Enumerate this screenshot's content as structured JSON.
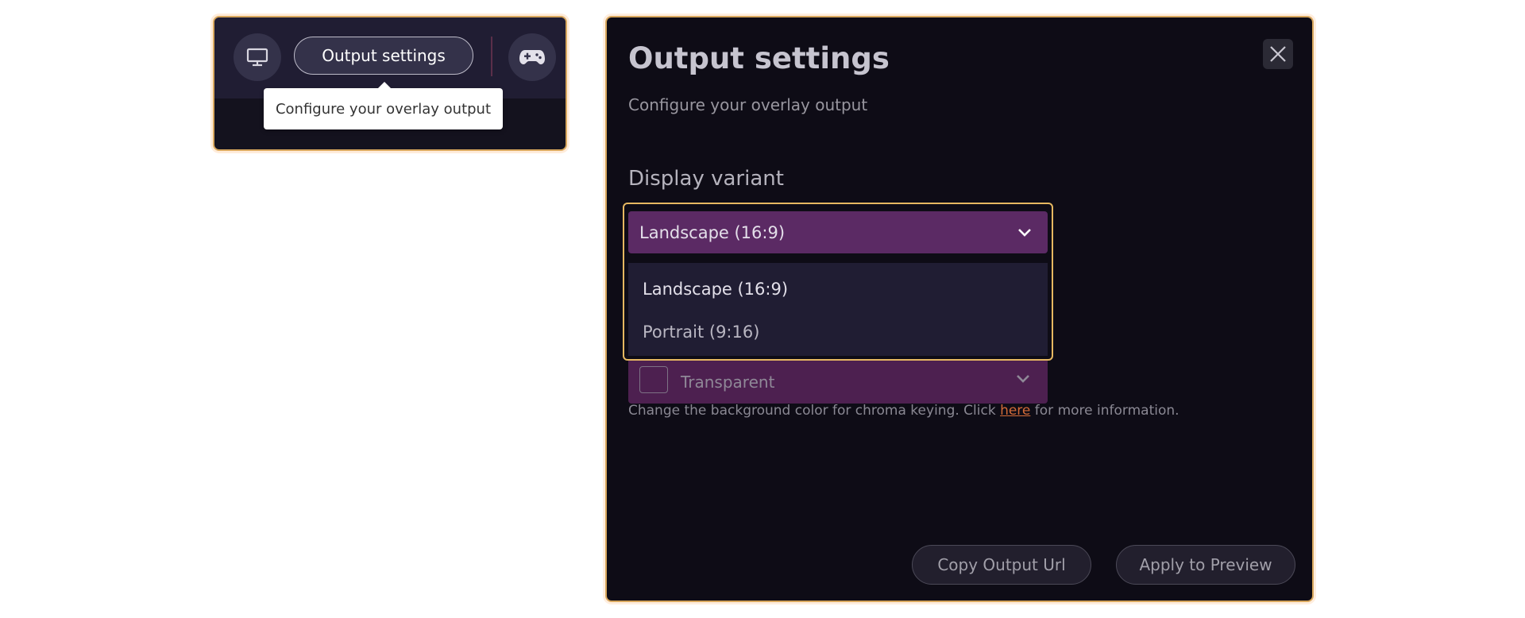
{
  "toolbar": {
    "monitor_icon": "monitor-icon",
    "output_settings_label": "Output settings",
    "gamepad_icon": "gamepad-icon",
    "tooltip": "Configure your overlay output"
  },
  "modal": {
    "title": "Output settings",
    "subtitle": "Configure your overlay output",
    "close_icon": "close-icon",
    "display_variant": {
      "label": "Display variant",
      "selected": "Landscape (16:9)",
      "options": [
        "Landscape (16:9)",
        "Portrait (9:16)"
      ]
    },
    "background": {
      "selected": "Transparent",
      "help_prefix": "Change the background color for chroma keying. Click ",
      "help_link": "here",
      "help_suffix": " for more information."
    },
    "footer": {
      "copy_label": "Copy Output Url",
      "apply_label": "Apply to Preview"
    }
  },
  "colors": {
    "accent_border": "#e6b861",
    "select_bg": "#5b2a64",
    "link": "#d26b38",
    "panel_bg": "#0e0c16"
  }
}
